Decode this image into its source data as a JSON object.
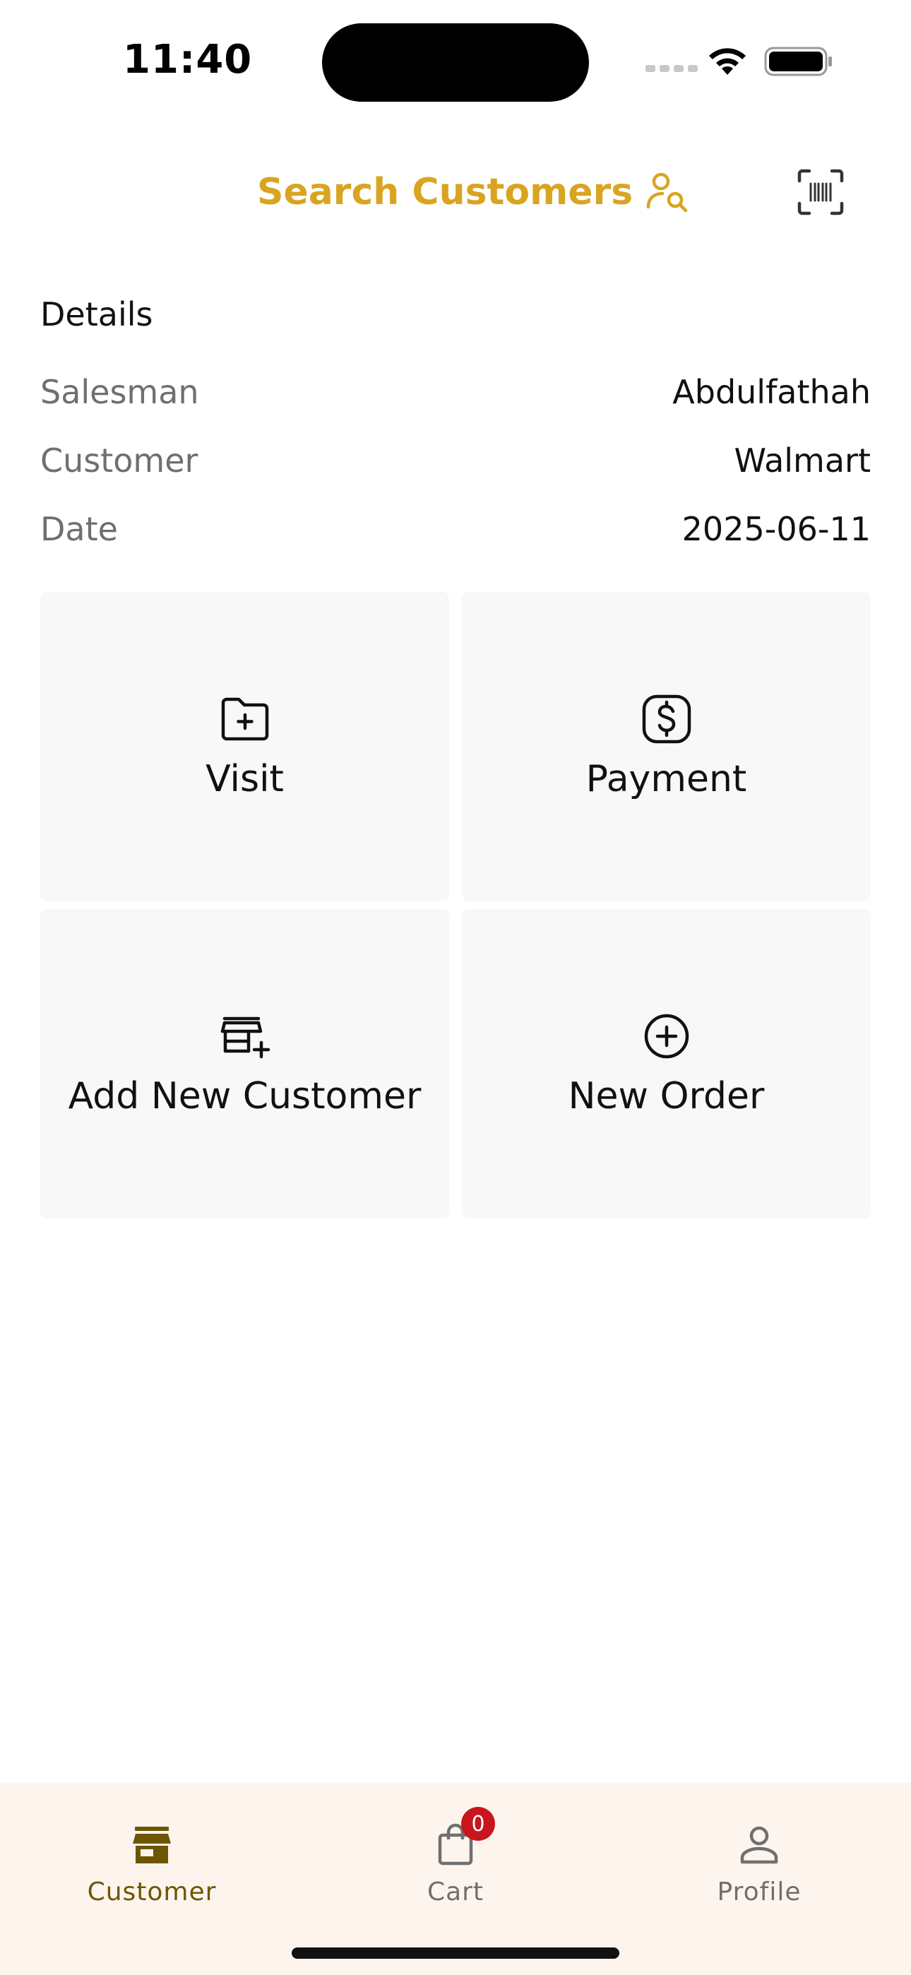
{
  "status_bar": {
    "time": "11:40"
  },
  "header": {
    "title": "Search Customers",
    "title_icon": "user-search-icon",
    "barcode_icon": "barcode-scan-icon",
    "accent_color": "#d9a520"
  },
  "details": {
    "title": "Details",
    "rows": [
      {
        "label": "Salesman",
        "value": "Abdulfathah"
      },
      {
        "label": "Customer",
        "value": "Walmart"
      },
      {
        "label": "Date",
        "value": "2025-06-11"
      }
    ]
  },
  "tiles": [
    {
      "label": "Visit",
      "icon": "folder-plus-icon"
    },
    {
      "label": "Payment",
      "icon": "dollar-icon"
    },
    {
      "label": "Add New Customer",
      "icon": "store-plus-icon"
    },
    {
      "label": "New Order",
      "icon": "plus-circle-icon"
    }
  ],
  "bottom_nav": {
    "items": [
      {
        "label": "Customer",
        "icon": "store-icon",
        "active": true
      },
      {
        "label": "Cart",
        "icon": "shopping-bag-icon",
        "badge": "0",
        "active": false
      },
      {
        "label": "Profile",
        "icon": "person-icon",
        "active": false
      }
    ],
    "active_color": "#6e5600",
    "badge_color": "#c8161c"
  }
}
